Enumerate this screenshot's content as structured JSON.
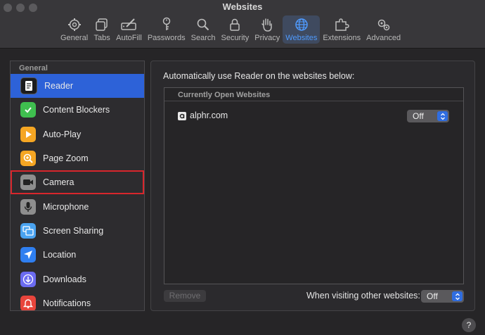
{
  "window": {
    "title": "Websites"
  },
  "toolbar": {
    "items": [
      {
        "label": "General",
        "icon": "gear-icon"
      },
      {
        "label": "Tabs",
        "icon": "tabs-icon"
      },
      {
        "label": "AutoFill",
        "icon": "pencil-icon"
      },
      {
        "label": "Passwords",
        "icon": "key-icon"
      },
      {
        "label": "Search",
        "icon": "search-icon"
      },
      {
        "label": "Security",
        "icon": "lock-icon"
      },
      {
        "label": "Privacy",
        "icon": "hand-icon"
      },
      {
        "label": "Websites",
        "icon": "globe-icon",
        "active": true
      },
      {
        "label": "Extensions",
        "icon": "puzzle-icon"
      },
      {
        "label": "Advanced",
        "icon": "gears-icon"
      }
    ]
  },
  "sidebar": {
    "header": "General",
    "items": [
      {
        "label": "Reader",
        "icon": "reader-icon",
        "color": "#ffffff",
        "selected": true
      },
      {
        "label": "Content Blockers",
        "icon": "checkmark-shield-icon",
        "color": "#3fbf4f"
      },
      {
        "label": "Auto-Play",
        "icon": "play-icon",
        "color": "#f5a623"
      },
      {
        "label": "Page Zoom",
        "icon": "zoom-icon",
        "color": "#f5a623"
      },
      {
        "label": "Camera",
        "icon": "camera-icon",
        "color": "#9b9b9b",
        "highlighted": true
      },
      {
        "label": "Microphone",
        "icon": "microphone-icon",
        "color": "#9b9b9b"
      },
      {
        "label": "Screen Sharing",
        "icon": "screen-sharing-icon",
        "color": "#4aa3f0"
      },
      {
        "label": "Location",
        "icon": "location-icon",
        "color": "#2f7ff0"
      },
      {
        "label": "Downloads",
        "icon": "download-icon",
        "color": "#6b6bf0"
      },
      {
        "label": "Notifications",
        "icon": "notifications-icon",
        "color": "#e8453c"
      }
    ]
  },
  "main": {
    "heading": "Automatically use Reader on the websites below:",
    "table": {
      "section_header": "Currently Open Websites",
      "rows": [
        {
          "site": "alphr.com",
          "setting": "Off"
        }
      ]
    },
    "remove_label": "Remove",
    "other_sites_label": "When visiting other websites:",
    "other_sites_value": "Off"
  },
  "help": {
    "label": "?"
  },
  "colors": {
    "accent": "#2d62d8",
    "highlight_border": "#d8262c",
    "active_tab_text": "#4f9bff"
  }
}
